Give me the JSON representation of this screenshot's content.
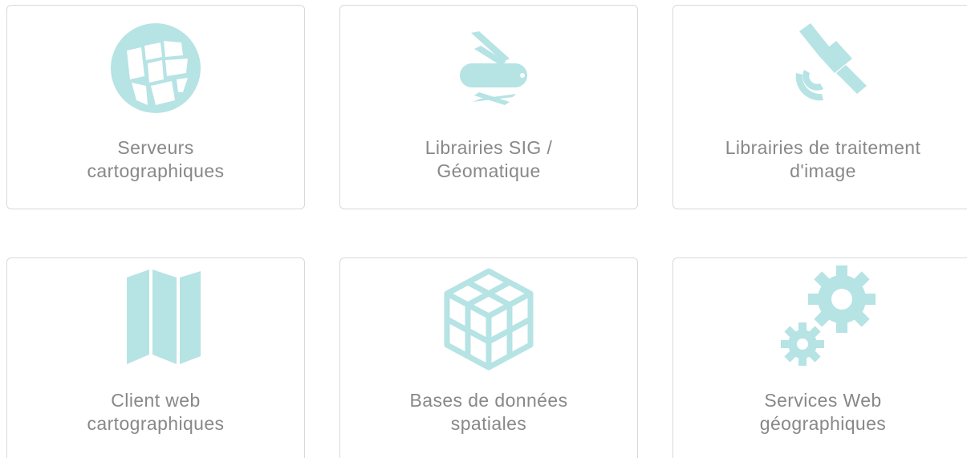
{
  "accent_color": "#b6e3e4",
  "cards": [
    {
      "icon": "map-globe-icon",
      "line1": "Serveurs",
      "line2": "cartographiques"
    },
    {
      "icon": "swiss-army-knife-icon",
      "line1": "Librairies SIG /",
      "line2": "Géomatique"
    },
    {
      "icon": "satellite-icon",
      "line1": "Librairies de traitement",
      "line2": "d'image"
    },
    {
      "icon": "folded-map-icon",
      "line1": "Client web",
      "line2": "cartographiques"
    },
    {
      "icon": "database-cube-icon",
      "line1": "Bases de données",
      "line2": "spatiales"
    },
    {
      "icon": "gears-icon",
      "line1": "Services Web",
      "line2": "géographiques"
    }
  ]
}
